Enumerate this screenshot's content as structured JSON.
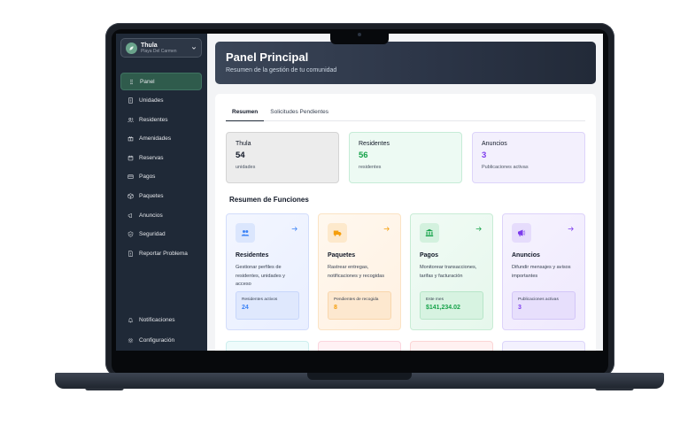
{
  "sidebar": {
    "community": {
      "name": "Thula",
      "location": "Playa Del Carmen"
    },
    "items": [
      {
        "label": "Panel",
        "icon": "grid-dots-icon",
        "active": true
      },
      {
        "label": "Unidades",
        "icon": "building-icon"
      },
      {
        "label": "Residentes",
        "icon": "users-icon"
      },
      {
        "label": "Amenidades",
        "icon": "gift-icon"
      },
      {
        "label": "Reservas",
        "icon": "calendar-icon"
      },
      {
        "label": "Pagos",
        "icon": "credit-card-icon"
      },
      {
        "label": "Paquetes",
        "icon": "package-icon"
      },
      {
        "label": "Anuncios",
        "icon": "megaphone-icon"
      },
      {
        "label": "Seguridad",
        "icon": "shield-icon"
      },
      {
        "label": "Reportar Problema",
        "icon": "report-icon"
      }
    ],
    "bottom": [
      {
        "label": "Notificaciones",
        "icon": "bell-icon"
      },
      {
        "label": "Configuración",
        "icon": "gear-icon"
      }
    ]
  },
  "header": {
    "title": "Panel Principal",
    "subtitle": "Resumen de la gestión de tu comunidad"
  },
  "tabs": [
    {
      "label": "Resumen",
      "active": true
    },
    {
      "label": "Solicitudes Pendientes"
    }
  ],
  "stats": [
    {
      "title": "Thula",
      "value": "54",
      "sub": "unidades",
      "color": "#111827"
    },
    {
      "title": "Residentes",
      "value": "56",
      "sub": "residentes",
      "color": "#16a34a"
    },
    {
      "title": "Anuncios",
      "value": "3",
      "sub": "Publicaciones activas",
      "color": "#7c3aed"
    }
  ],
  "section_title": "Resumen de Funciones",
  "features": [
    {
      "title": "Residentes",
      "desc": "Gestionar perfiles de residentes, unidades y acceso",
      "stat_label": "Residentes activos",
      "stat_value": "24",
      "accent": "#3b82f6",
      "icon": "users-icon"
    },
    {
      "title": "Paquetes",
      "desc": "Rastrear entregas, notificaciones y recogidas",
      "stat_label": "Pendientes de recogida",
      "stat_value": "8",
      "accent": "#f59e0b",
      "icon": "truck-icon"
    },
    {
      "title": "Pagos",
      "desc": "Monitorear transacciones, tarifas y facturación",
      "stat_label": "Este mes",
      "stat_value": "$141,234.02",
      "accent": "#16a34a",
      "icon": "bank-icon"
    },
    {
      "title": "Anuncios",
      "desc": "Difundir mensajes y avisos importantes",
      "stat_label": "Publicaciones activas",
      "stat_value": "3",
      "accent": "#7c3aed",
      "icon": "megaphone-icon"
    }
  ]
}
